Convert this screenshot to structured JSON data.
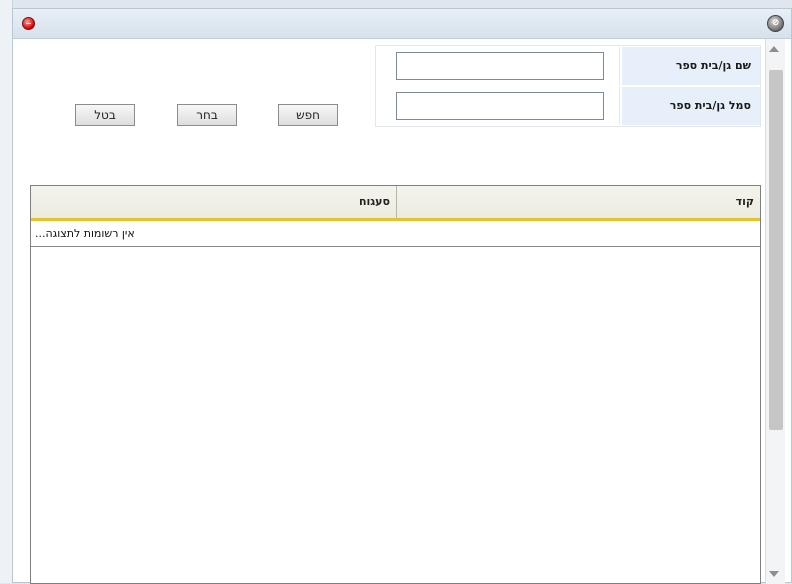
{
  "form": {
    "school_name_label": "שם גן/בית ספר",
    "school_name_value": "",
    "school_code_label": "סמל גן/בית ספר",
    "school_code_value": ""
  },
  "buttons": {
    "search": "חפש",
    "select": "בחר",
    "cancel": "בטל"
  },
  "grid": {
    "columns": [
      "קוד",
      "סעגוח"
    ],
    "empty_message": "אין רשומות לתצוגה..."
  },
  "colors": {
    "header_underline": "#e2c430",
    "label_background": "#e6effa"
  }
}
